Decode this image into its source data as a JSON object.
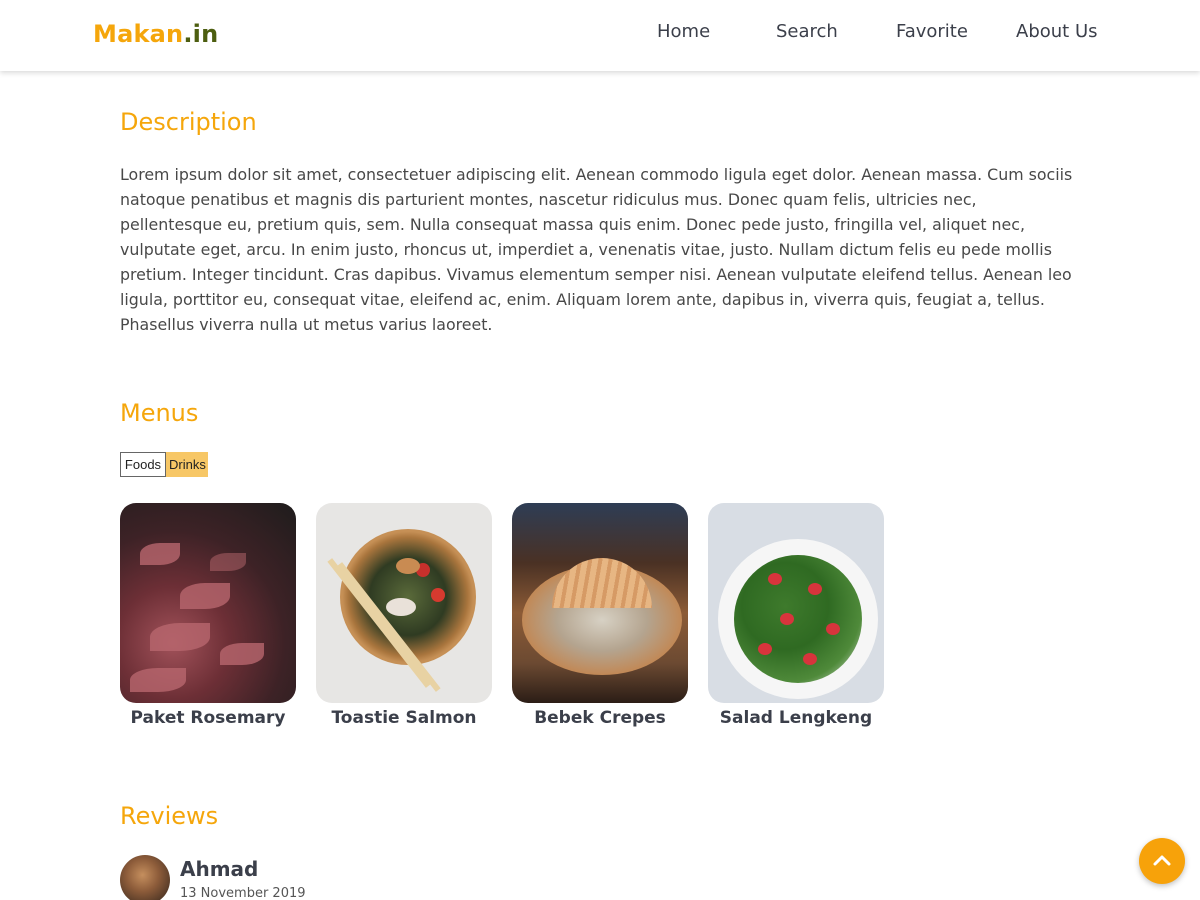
{
  "header": {
    "logo_brand": "Makan",
    "logo_tld": ".in",
    "nav": [
      "Home",
      "Search",
      "Favorite",
      "About Us"
    ]
  },
  "description": {
    "heading": "Description",
    "text": "Lorem ipsum dolor sit amet, consectetuer adipiscing elit. Aenean commodo ligula eget dolor. Aenean massa. Cum sociis natoque penatibus et magnis dis parturient montes, nascetur ridiculus mus. Donec quam felis, ultricies nec, pellentesque eu, pretium quis, sem. Nulla consequat massa quis enim. Donec pede justo, fringilla vel, aliquet nec, vulputate eget, arcu. In enim justo, rhoncus ut, imperdiet a, venenatis vitae, justo. Nullam dictum felis eu pede mollis pretium. Integer tincidunt. Cras dapibus. Vivamus elementum semper nisi. Aenean vulputate eleifend tellus. Aenean leo ligula, porttitor eu, consequat vitae, eleifend ac, enim. Aliquam lorem ante, dapibus in, viverra quis, feugiat a, tellus. Phasellus viverra nulla ut metus varius laoreet."
  },
  "menus": {
    "heading": "Menus",
    "tabs": [
      "Foods",
      "Drinks"
    ],
    "active_tab": "Drinks",
    "items": [
      {
        "name": "Paket Rosemary"
      },
      {
        "name": "Toastie Salmon"
      },
      {
        "name": "Bebek Crepes"
      },
      {
        "name": "Salad Lengkeng"
      }
    ]
  },
  "reviews": {
    "heading": "Reviews",
    "items": [
      {
        "name": "Ahmad",
        "date": "13 November 2019"
      }
    ]
  },
  "colors": {
    "accent": "#f5a60b",
    "logo_tld": "#4d5e10",
    "active_tab": "#f7c766"
  },
  "icons": {
    "back_to_top": "chevron-up-icon"
  }
}
